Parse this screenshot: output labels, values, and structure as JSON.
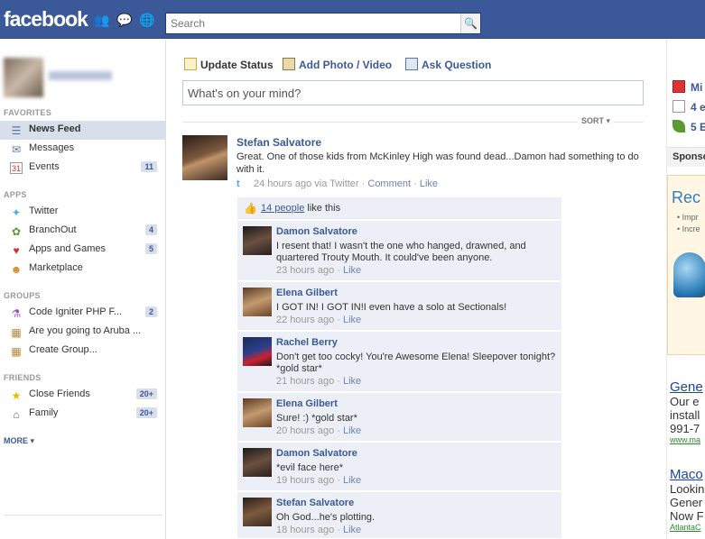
{
  "app": {
    "logo": "facebook"
  },
  "search": {
    "placeholder": "Search"
  },
  "sidebar": {
    "favorites_title": "FAVORITES",
    "apps_title": "APPS",
    "groups_title": "GROUPS",
    "friends_title": "FRIENDS",
    "more": "MORE",
    "favorites": [
      {
        "label": "News Feed",
        "icon": "news-feed-icon",
        "count": ""
      },
      {
        "label": "Messages",
        "icon": "messages-icon",
        "count": ""
      },
      {
        "label": "Events",
        "icon": "events-icon",
        "count": "11"
      }
    ],
    "apps": [
      {
        "label": "Twitter",
        "icon": "twitter-bird-icon",
        "count": ""
      },
      {
        "label": "BranchOut",
        "icon": "leaf-icon",
        "count": "4"
      },
      {
        "label": "Apps and Games",
        "icon": "apps-games-icon",
        "count": "5"
      },
      {
        "label": "Marketplace",
        "icon": "marketplace-icon",
        "count": ""
      }
    ],
    "groups": [
      {
        "label": "Code Igniter PHP F...",
        "icon": "flask-icon",
        "count": "2"
      },
      {
        "label": "Are you going to Aruba ...",
        "icon": "group-icon",
        "count": ""
      },
      {
        "label": "Create Group...",
        "icon": "create-group-icon",
        "count": ""
      }
    ],
    "friends": [
      {
        "label": "Close Friends",
        "icon": "star-icon",
        "count": "20+"
      },
      {
        "label": "Family",
        "icon": "house-icon",
        "count": "20+"
      }
    ]
  },
  "composer": {
    "update_status": "Update Status",
    "add_photo": "Add Photo / Video",
    "ask_question": "Ask Question",
    "placeholder": "What's on your mind?",
    "sort": "SORT"
  },
  "story": {
    "author": "Stefan Salvatore",
    "text": "Great. One of those kids from McKinley High was found dead...Damon had something to do with it.",
    "time": "24 hours ago via Twitter",
    "comment_link": "Comment",
    "like_link": "Like",
    "likes_link": "14 people",
    "likes_suffix": " like this",
    "comments": [
      {
        "author": "Damon Salvatore",
        "text": "I resent that! I wasn't the one who hanged, drawned, and quartered Trouty Mouth. It could've been anyone.",
        "time": "23 hours ago",
        "like": "Like"
      },
      {
        "author": "Elena Gilbert",
        "text": "I GOT IN! I GOT IN!I even have a solo at Sectionals!",
        "time": "22 hours ago",
        "like": "Like"
      },
      {
        "author": "Rachel Berry",
        "text": "Don't get too cocky! You're Awesome Elena! Sleepover tonight? *gold star*",
        "time": "21 hours ago",
        "like": "Like"
      },
      {
        "author": "Elena Gilbert",
        "text": "Sure! :) *gold star*",
        "time": "20 hours ago",
        "like": "Like"
      },
      {
        "author": "Damon Salvatore",
        "text": "*evil face here*",
        "time": "19 hours ago",
        "like": "Like"
      },
      {
        "author": "Stefan Salvatore",
        "text": "Oh God...he's plotting.",
        "time": "18 hours ago",
        "like": "Like"
      }
    ]
  },
  "right": {
    "items": [
      {
        "label": "Mi",
        "icon": "gift-icon"
      },
      {
        "label": "4 e",
        "icon": "calendar-icon"
      },
      {
        "label": "5 E",
        "icon": "leaf-icon"
      }
    ],
    "sponsored": "Sponsored",
    "ad_box": {
      "title": "Rec",
      "bullet1": "• Impr",
      "bullet2": "• Incre"
    },
    "ads": [
      {
        "title": "Gene",
        "l1": "Our e",
        "l2": "install",
        "l3": "991-7",
        "url": "www.ma"
      },
      {
        "title": "Maco",
        "l1": "Lookin",
        "l2": "Gener",
        "l3": "Now F",
        "url": "AtlantaC"
      }
    ]
  }
}
